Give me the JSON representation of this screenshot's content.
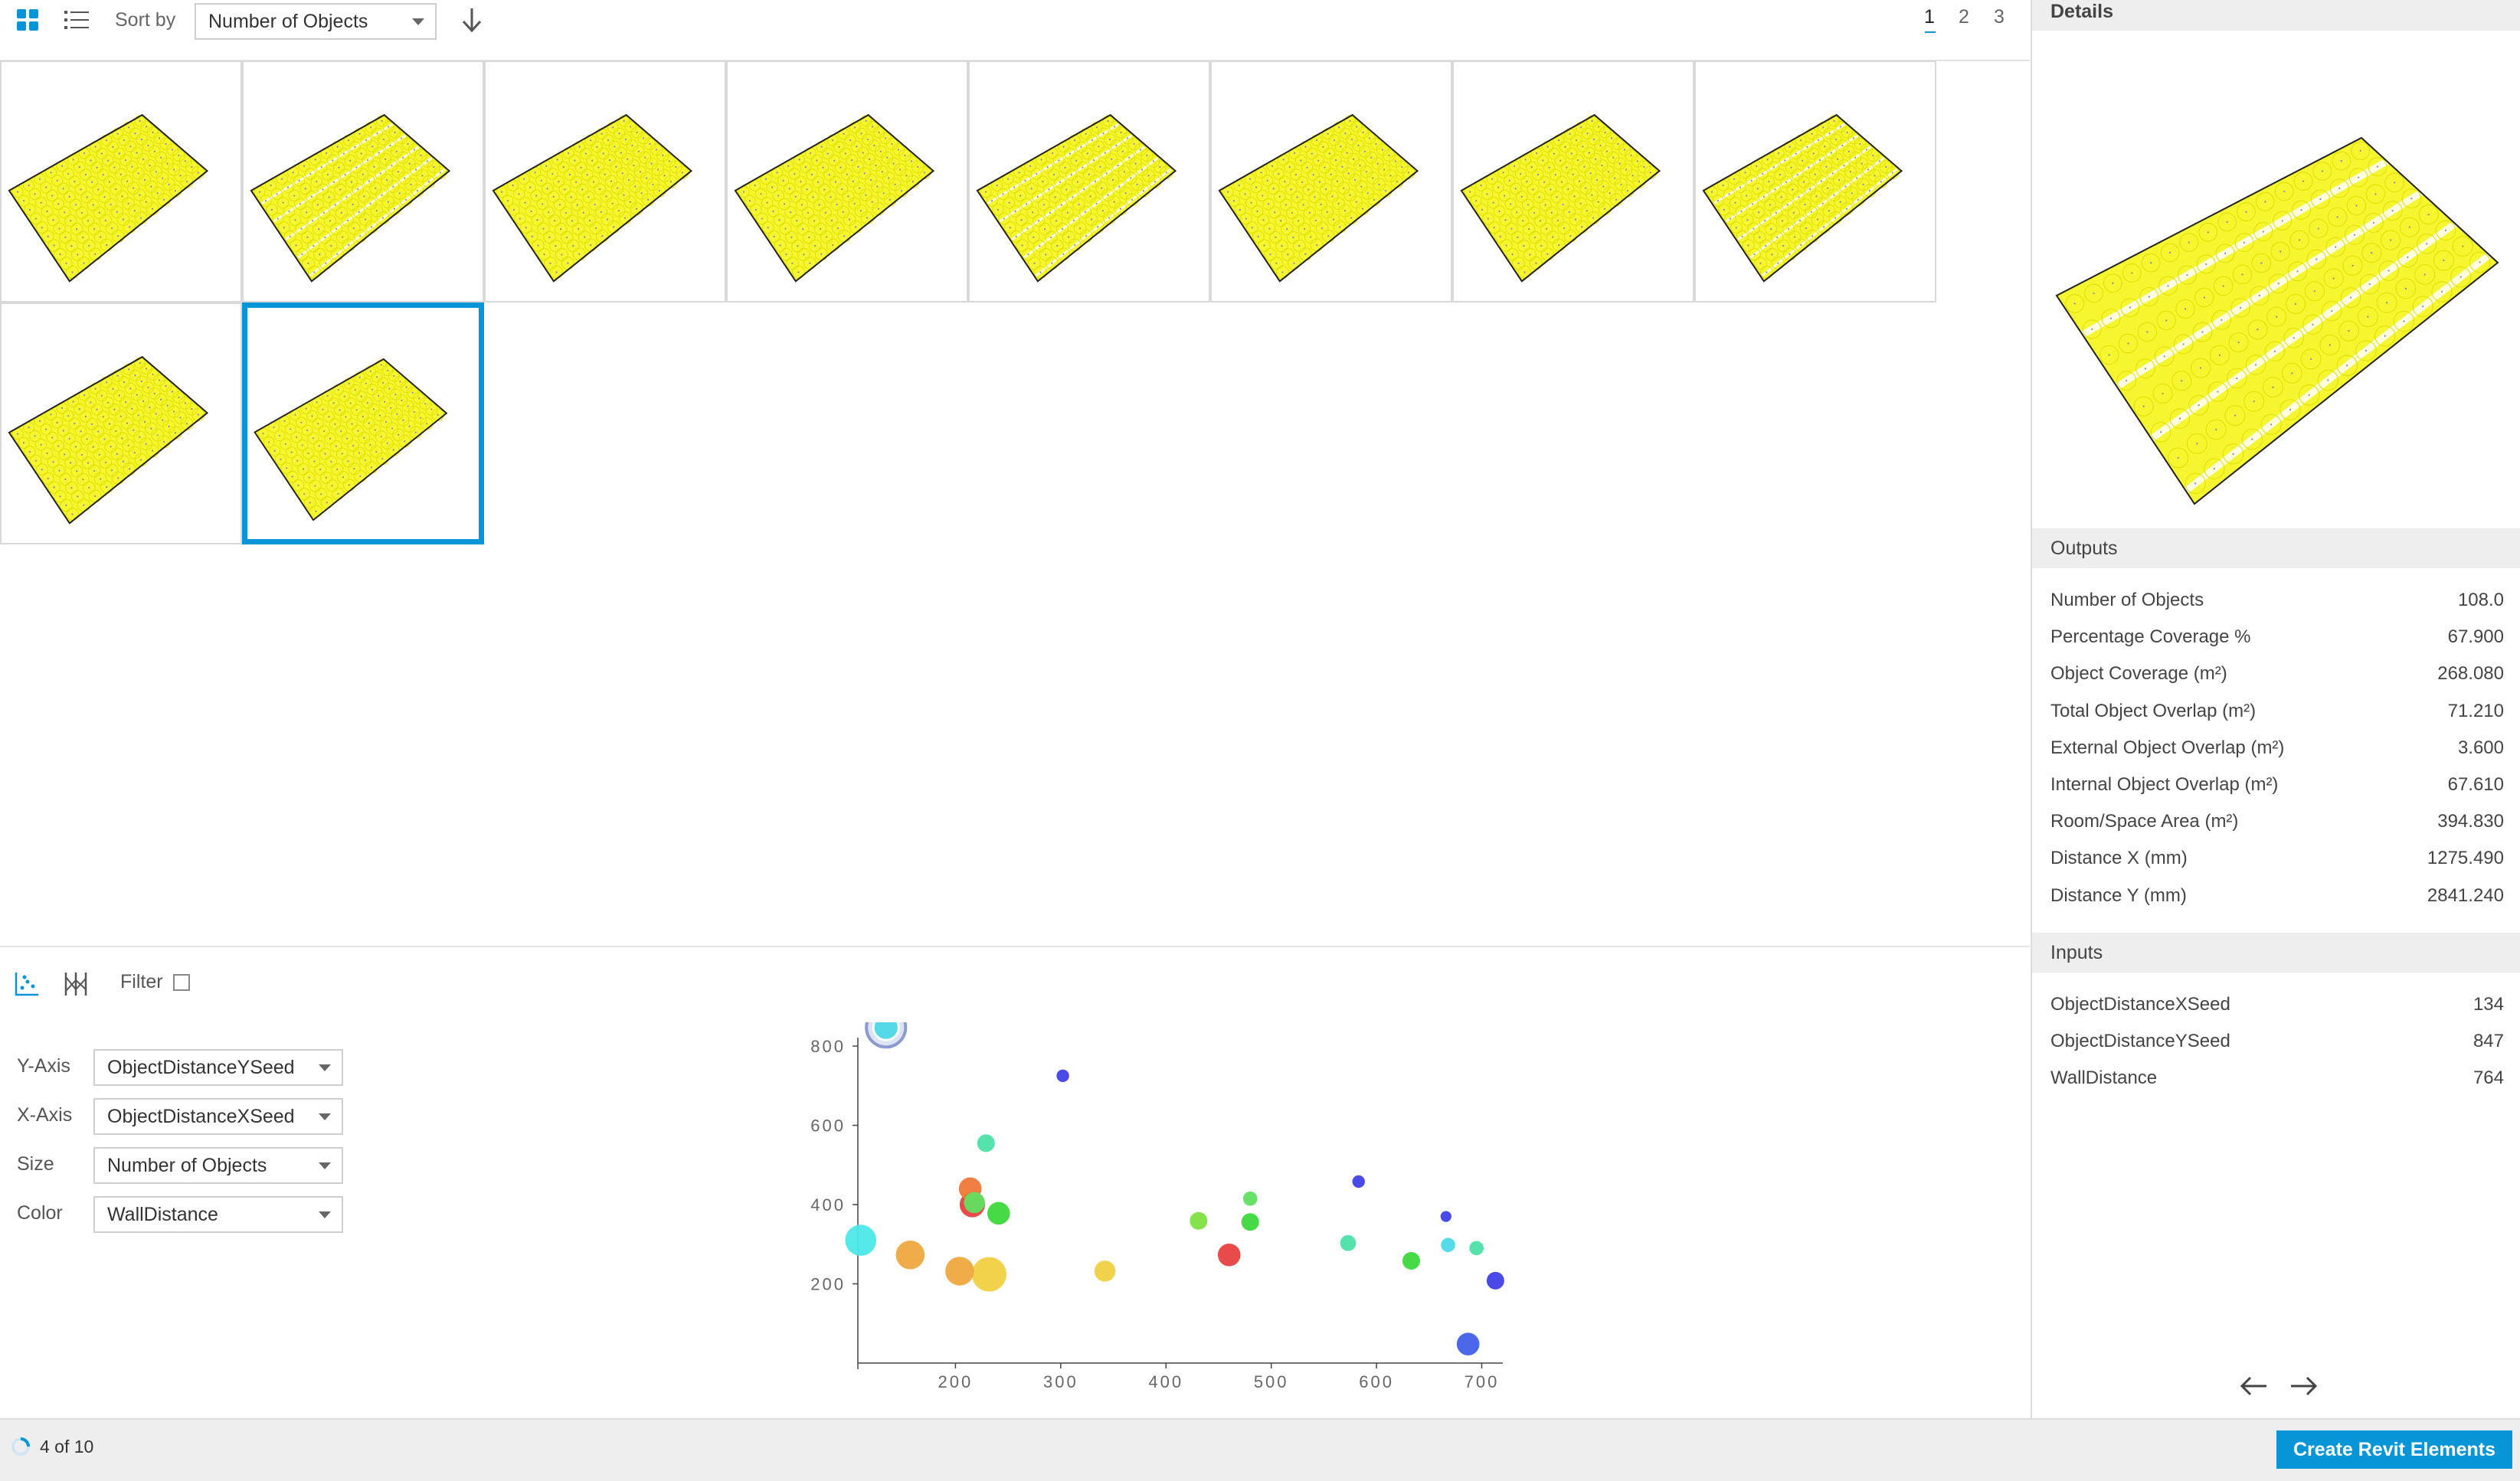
{
  "toolbar": {
    "sort_label": "Sort by",
    "sort_value": "Number of Objects",
    "pages": [
      "1",
      "2",
      "3"
    ],
    "active_page": "1",
    "icons": [
      "grid-view-icon",
      "list-view-icon",
      "sort-direction-icon"
    ]
  },
  "grid": {
    "tile_count": 10,
    "selected_index": 9
  },
  "chart_controls": {
    "filter_label": "Filter",
    "filter_checked": false,
    "y_axis": {
      "label": "Y-Axis",
      "value": "ObjectDistanceYSeed"
    },
    "x_axis": {
      "label": "X-Axis",
      "value": "ObjectDistanceXSeed"
    },
    "size": {
      "label": "Size",
      "value": "Number of Objects"
    },
    "color": {
      "label": "Color",
      "value": "WallDistance"
    }
  },
  "chart_data": {
    "type": "scatter",
    "title": "",
    "xlabel": "",
    "ylabel": "",
    "xlim": [
      100,
      720
    ],
    "ylim": [
      0,
      860
    ],
    "x_ticks": [
      "200",
      "300",
      "400",
      "500",
      "600",
      "700"
    ],
    "y_ticks": [
      "200",
      "400",
      "600",
      "800"
    ],
    "points": [
      {
        "x": 134,
        "y": 847,
        "size": 108,
        "color": "#4dd9e8",
        "selected": true
      },
      {
        "x": 302,
        "y": 725,
        "size": 70,
        "color": "#4040e8"
      },
      {
        "x": 229,
        "y": 555,
        "size": 85,
        "color": "#4de0a8"
      },
      {
        "x": 214,
        "y": 440,
        "size": 100,
        "color": "#f07838"
      },
      {
        "x": 216,
        "y": 400,
        "size": 108,
        "color": "#e84040"
      },
      {
        "x": 218,
        "y": 405,
        "size": 95,
        "color": "#60e060"
      },
      {
        "x": 241,
        "y": 378,
        "size": 100,
        "color": "#3cd83c"
      },
      {
        "x": 110,
        "y": 310,
        "size": 125,
        "color": "#4de8e8"
      },
      {
        "x": 157,
        "y": 273,
        "size": 118,
        "color": "#f0a840"
      },
      {
        "x": 204,
        "y": 232,
        "size": 118,
        "color": "#f0a840"
      },
      {
        "x": 232,
        "y": 224,
        "size": 135,
        "color": "#f0d040"
      },
      {
        "x": 342,
        "y": 232,
        "size": 95,
        "color": "#f0d040"
      },
      {
        "x": 431,
        "y": 359,
        "size": 85,
        "color": "#80e040"
      },
      {
        "x": 480,
        "y": 415,
        "size": 75,
        "color": "#60e060"
      },
      {
        "x": 480,
        "y": 356,
        "size": 85,
        "color": "#3cd83c"
      },
      {
        "x": 460,
        "y": 273,
        "size": 100,
        "color": "#e84040"
      },
      {
        "x": 573,
        "y": 303,
        "size": 80,
        "color": "#4de0a8"
      },
      {
        "x": 583,
        "y": 458,
        "size": 70,
        "color": "#4040e8"
      },
      {
        "x": 633,
        "y": 258,
        "size": 85,
        "color": "#3cd83c"
      },
      {
        "x": 666,
        "y": 370,
        "size": 65,
        "color": "#4040e8"
      },
      {
        "x": 668,
        "y": 298,
        "size": 75,
        "color": "#4dd9e8"
      },
      {
        "x": 695,
        "y": 290,
        "size": 75,
        "color": "#4de0a8"
      },
      {
        "x": 713,
        "y": 208,
        "size": 85,
        "color": "#4040e8"
      },
      {
        "x": 687,
        "y": 48,
        "size": 100,
        "color": "#4060e8"
      }
    ]
  },
  "details": {
    "title": "Details",
    "outputs_title": "Outputs",
    "outputs": [
      {
        "label": "Number of Objects",
        "value": "108.0"
      },
      {
        "label": "Percentage Coverage %",
        "value": "67.900"
      },
      {
        "label": "Object Coverage (m²)",
        "value": "268.080"
      },
      {
        "label": "Total Object Overlap (m²)",
        "value": "71.210"
      },
      {
        "label": "External Object Overlap (m²)",
        "value": "3.600"
      },
      {
        "label": "Internal Object Overlap (m²)",
        "value": "67.610"
      },
      {
        "label": "Room/Space Area (m²)",
        "value": "394.830"
      },
      {
        "label": "Distance X (mm)",
        "value": "1275.490"
      },
      {
        "label": "Distance Y (mm)",
        "value": "2841.240"
      }
    ],
    "inputs_title": "Inputs",
    "inputs": [
      {
        "label": "ObjectDistanceXSeed",
        "value": "134"
      },
      {
        "label": "ObjectDistanceYSeed",
        "value": "847"
      },
      {
        "label": "WallDistance",
        "value": "764"
      }
    ]
  },
  "status": {
    "text": "4 of 10",
    "create_button": "Create Revit Elements"
  },
  "colors": {
    "accent": "#0696d7",
    "preview_fill": "#f5f530"
  }
}
